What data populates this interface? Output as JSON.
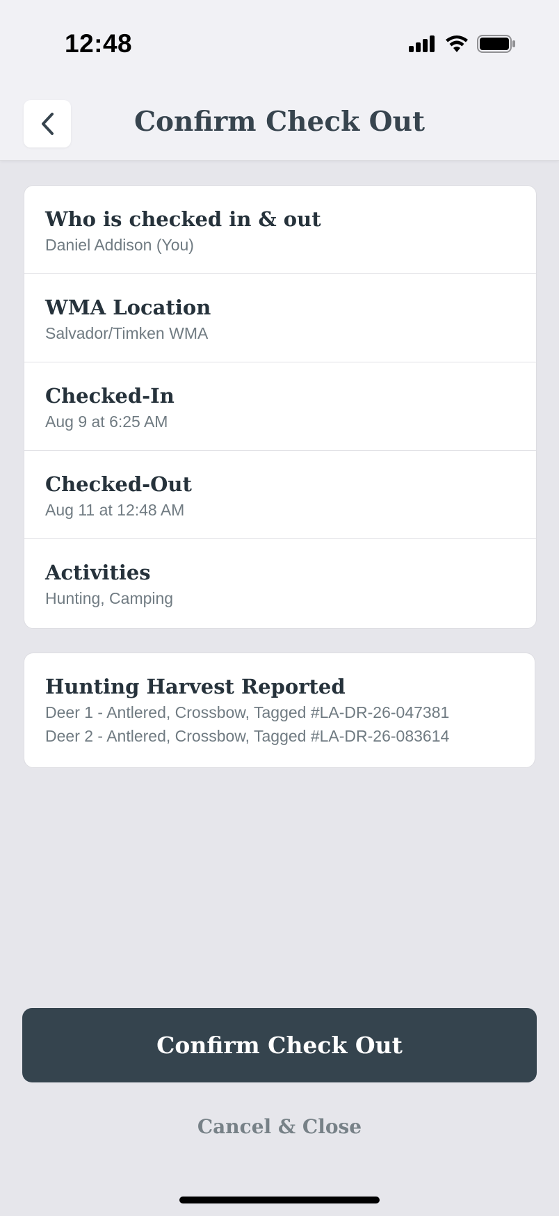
{
  "status_bar": {
    "time": "12:48"
  },
  "header": {
    "title": "Confirm Check Out",
    "back_icon": "chevron-left-icon"
  },
  "details": [
    {
      "title": "Who is checked in & out",
      "value": "Daniel Addison (You)"
    },
    {
      "title": "WMA Location",
      "value": "Salvador/Timken WMA"
    },
    {
      "title": "Checked-In",
      "value": "Aug 9 at 6:25 AM"
    },
    {
      "title": "Checked-Out",
      "value": "Aug 11 at 12:48 AM"
    },
    {
      "title": "Activities",
      "value": "Hunting, Camping"
    }
  ],
  "harvest": {
    "title": "Hunting Harvest Reported",
    "items": [
      "Deer 1 - Antlered, Crossbow, Tagged #LA-DR-26-047381",
      "Deer 2 - Antlered, Crossbow, Tagged #LA-DR-26-083614"
    ]
  },
  "actions": {
    "confirm_label": "Confirm Check Out",
    "cancel_label": "Cancel & Close"
  },
  "colors": {
    "primary": "#35444e",
    "background": "#e6e6eb",
    "card": "#ffffff",
    "muted_text": "#707b82"
  }
}
